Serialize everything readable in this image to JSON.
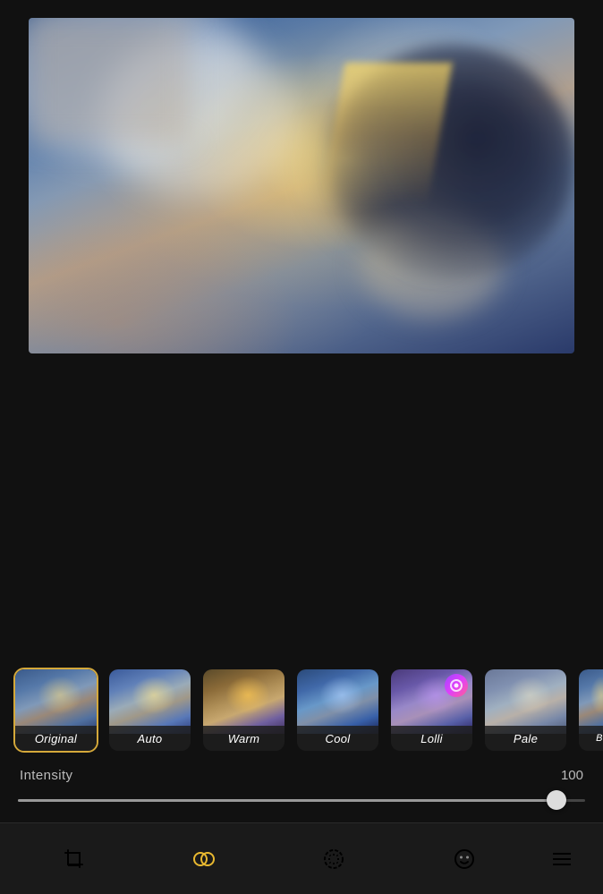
{
  "app": {
    "background": "#111"
  },
  "image": {
    "alt": "Sky with dramatic clouds and sunbeams"
  },
  "filters": [
    {
      "id": "original",
      "label": "Original",
      "active": true,
      "type": "original"
    },
    {
      "id": "auto",
      "label": "Auto",
      "active": false,
      "type": "auto"
    },
    {
      "id": "warm",
      "label": "Warm",
      "active": false,
      "type": "warm"
    },
    {
      "id": "cool",
      "label": "Cool",
      "active": false,
      "type": "cool"
    },
    {
      "id": "lolli",
      "label": "Lolli",
      "active": false,
      "type": "lolli",
      "badge": true
    },
    {
      "id": "pale",
      "label": "Pale",
      "active": false,
      "type": "pale"
    },
    {
      "id": "partial",
      "label": "B",
      "active": false,
      "type": "partial",
      "partial": true
    }
  ],
  "intensity": {
    "label": "Intensity",
    "value": "100",
    "percent": 95
  },
  "nav": {
    "items": [
      {
        "id": "crop",
        "label": "crop",
        "active": false
      },
      {
        "id": "filter",
        "label": "filter",
        "active": true
      },
      {
        "id": "adjust",
        "label": "adjust",
        "active": false
      },
      {
        "id": "sticker",
        "label": "sticker",
        "active": false
      },
      {
        "id": "more",
        "label": "more",
        "active": false
      }
    ]
  }
}
